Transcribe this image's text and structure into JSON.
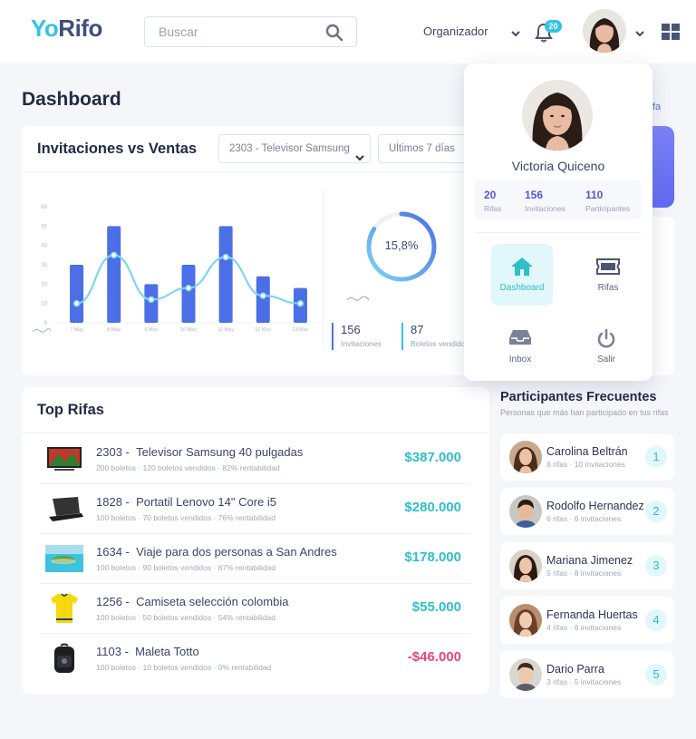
{
  "brand": {
    "part1": "Yo",
    "part2": "Rifo"
  },
  "search": {
    "placeholder": "Buscar"
  },
  "header": {
    "role": "Organizador",
    "notifications": "20"
  },
  "page": {
    "title": "Dashboard"
  },
  "invitaciones_card": {
    "title": "Invitaciones vs Ventas",
    "select_rifa": "2303 - Televisor Samsung",
    "select_period": "Ultimos 7 días",
    "donut_value": "15,8%",
    "donut_fraction": 0.84,
    "stats": [
      {
        "value": "156",
        "label": "Invitaciones"
      },
      {
        "value": "87",
        "label": "Boletos vendidos"
      }
    ]
  },
  "chart_data": {
    "type": "bar",
    "categories": [
      "7 May",
      "8 May",
      "9 May",
      "10 May",
      "11 May",
      "12 May",
      "13 May"
    ],
    "series": [
      {
        "name": "",
        "type": "bar",
        "values": [
          30,
          50,
          20,
          30,
          50,
          24,
          18
        ]
      },
      {
        "name": "",
        "type": "line",
        "values": [
          10,
          35,
          12,
          18,
          34,
          14,
          10
        ]
      }
    ],
    "yticks": [
      "0",
      "10",
      "20",
      "30",
      "40",
      "50",
      "60"
    ],
    "ylim": [
      0,
      60
    ],
    "grid": false,
    "colors": {
      "bars": "#4b6fe6",
      "line": "#7fd4f3"
    }
  },
  "top_rifas": {
    "title": "Top Rifas",
    "items": [
      {
        "id": "2303",
        "name": "Televisor Samsung 40 pulgadas",
        "meta": "200 boletos · 120 boletos vendidos · 82% rentabilidad",
        "amount": "$387.000",
        "image": "tv-icon"
      },
      {
        "id": "1828",
        "name": "Portatil Lenovo 14\" Core i5",
        "meta": "100 boletos · 70 boletos vendidos · 76% rentabilidad",
        "amount": "$280.000",
        "image": "laptop-icon"
      },
      {
        "id": "1634",
        "name": "Viaje para dos personas a San Andres",
        "meta": "100 boletos · 90 boletos vendidos · 67% rentabilidad",
        "amount": "$178.000",
        "image": "beach-icon"
      },
      {
        "id": "1256",
        "name": "Camiseta selección colombia",
        "meta": "100 boletos · 50 boletos vendidos · 54% rentabilidad",
        "amount": "$55.000",
        "image": "shirt-icon"
      },
      {
        "id": "1103",
        "name": "Maleta Totto",
        "meta": "100 boletos · 10 boletos vendidos · 0% rentabilidad",
        "amount": "-$46.000",
        "image": "backpack-icon"
      }
    ]
  },
  "frecuentes": {
    "title": "Participantes Frecuentes",
    "subtitle": "Personas que más han participado en tus rifas",
    "items": [
      {
        "name": "Carolina Beltrán",
        "meta": "8 rifas · 10 invitaciones",
        "rank": "1"
      },
      {
        "name": "Rodolfo Hernandez",
        "meta": "6 rifas · 6 invitaciones",
        "rank": "2"
      },
      {
        "name": "Mariana Jimenez",
        "meta": "5 rifas · 8 invitaciones",
        "rank": "3"
      },
      {
        "name": "Fernanda Huertas",
        "meta": "4 rifas · 6 invitaciones",
        "rank": "4"
      },
      {
        "name": "Dario Parra",
        "meta": "3 rifas · 5 invitaciones",
        "rank": "5"
      }
    ]
  },
  "side_link": "fa",
  "profile_popup": {
    "name": "Victoria Quiceno",
    "stats": [
      {
        "value": "20",
        "label": "Rifas"
      },
      {
        "value": "156",
        "label": "Invitaciones"
      },
      {
        "value": "110",
        "label": "Participantes"
      }
    ],
    "nav": [
      {
        "label": "Dashboard",
        "icon": "home-icon",
        "active": true
      },
      {
        "label": "Rifas",
        "icon": "ticket-icon",
        "active": false
      },
      {
        "label": "Inbox",
        "icon": "inbox-icon",
        "active": false
      },
      {
        "label": "Salir",
        "icon": "power-icon",
        "active": false
      }
    ]
  }
}
